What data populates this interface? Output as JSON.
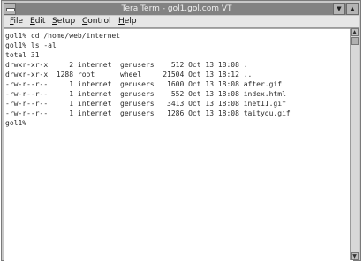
{
  "window": {
    "title": "Tera Term - gol1.gol.com VT",
    "minimize_glyph": "▼",
    "maximize_glyph": "▲"
  },
  "menu": {
    "items": [
      {
        "accel": "F",
        "rest": "ile"
      },
      {
        "accel": "E",
        "rest": "dit"
      },
      {
        "accel": "S",
        "rest": "etup"
      },
      {
        "accel": "C",
        "rest": "ontrol"
      },
      {
        "accel": "H",
        "rest": "elp"
      }
    ]
  },
  "terminal": {
    "lines": [
      "gol1% cd /home/web/internet",
      "gol1% ls -al",
      "total 31",
      "drwxr-xr-x     2 internet  genusers    512 Oct 13 18:08 .",
      "drwxr-xr-x  1288 root      wheel     21504 Oct 13 18:12 ..",
      "-rw-r--r--     1 internet  genusers   1600 Oct 13 18:08 after.gif",
      "-rw-r--r--     1 internet  genusers    552 Oct 13 18:08 index.html",
      "-rw-r--r--     1 internet  genusers   3413 Oct 13 18:08 inet11.gif",
      "-rw-r--r--     1 internet  genusers   1286 Oct 13 18:08 taityou.gif",
      "gol1%"
    ]
  },
  "scrollbar": {
    "up_glyph": "▲",
    "down_glyph": "▼",
    "position": 0
  }
}
